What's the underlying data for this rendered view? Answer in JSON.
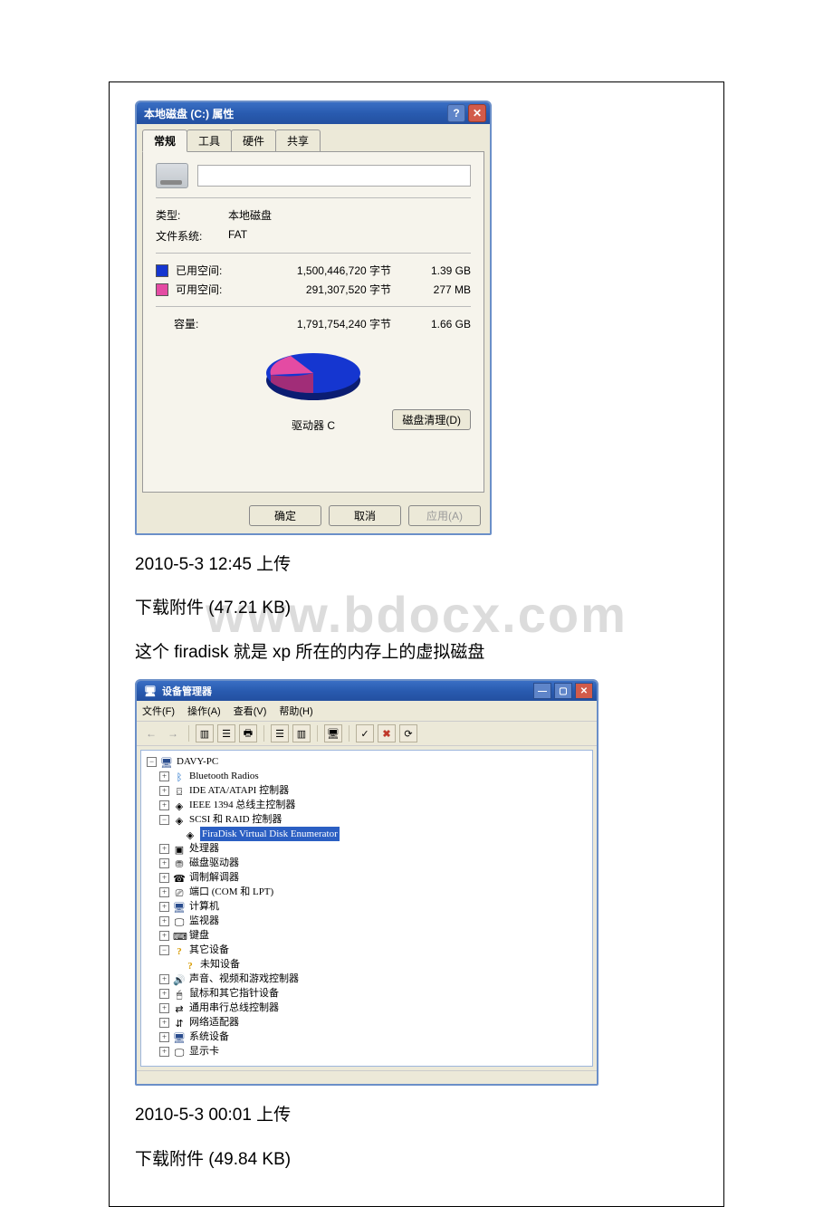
{
  "watermark": "www.bdocx.com",
  "props": {
    "title": "本地磁盘 (C:) 属性",
    "tabs": {
      "general": "常规",
      "tools": "工具",
      "hardware": "硬件",
      "sharing": "共享"
    },
    "labels": {
      "type": "类型:",
      "fs": "文件系统:",
      "used": "已用空间:",
      "free": "可用空间:",
      "capacity": "容量:"
    },
    "values": {
      "type": "本地磁盘",
      "fs": "FAT",
      "used_bytes": "1,500,446,720 字节",
      "used_size": "1.39 GB",
      "free_bytes": "291,307,520 字节",
      "free_size": "277 MB",
      "cap_bytes": "1,791,754,240 字节",
      "cap_size": "1.66 GB"
    },
    "pie_caption": "驱动器 C",
    "buttons": {
      "cleanup": "磁盘清理(D)",
      "ok": "确定",
      "cancel": "取消",
      "apply": "应用(A)"
    }
  },
  "article": {
    "upload1": "2010-5-3 12:45 上传",
    "dl1": "下载附件 (47.21 KB)",
    "desc": "这个 firadisk 就是 xp 所在的内存上的虚拟磁盘",
    "upload2": "2010-5-3 00:01 上传",
    "dl2": "下载附件 (49.84 KB)"
  },
  "devmgr": {
    "title": "设备管理器",
    "menu": {
      "file": "文件(F)",
      "action": "操作(A)",
      "view": "查看(V)",
      "help": "帮助(H)"
    },
    "tree": {
      "root": "DAVY-PC",
      "n_bt": "Bluetooth Radios",
      "n_ide": "IDE ATA/ATAPI 控制器",
      "n_1394": "IEEE 1394 总线主控制器",
      "n_scsi": "SCSI 和 RAID 控制器",
      "n_fira": "FiraDisk Virtual Disk Enumerator",
      "n_cpu": "处理器",
      "n_diskdrv": "磁盘驱动器",
      "n_modem": "调制解调器",
      "n_ports": "端口 (COM 和 LPT)",
      "n_comp": "计算机",
      "n_monitor": "监视器",
      "n_kb": "键盘",
      "n_other": "其它设备",
      "n_unknown": "未知设备",
      "n_sound": "声音、视频和游戏控制器",
      "n_mouse": "鼠标和其它指针设备",
      "n_usb": "通用串行总线控制器",
      "n_net": "网络适配器",
      "n_sys": "系统设备",
      "n_gpu": "显示卡"
    }
  },
  "chart_data": {
    "type": "pie",
    "title": "驱动器 C",
    "series": [
      {
        "name": "已用空间",
        "value": 1500446720,
        "display": "1.39 GB",
        "color": "#1536d0"
      },
      {
        "name": "可用空间",
        "value": 291307520,
        "display": "277 MB",
        "color": "#e44ba3"
      }
    ],
    "total": {
      "name": "容量",
      "value": 1791754240,
      "display": "1.66 GB"
    }
  }
}
